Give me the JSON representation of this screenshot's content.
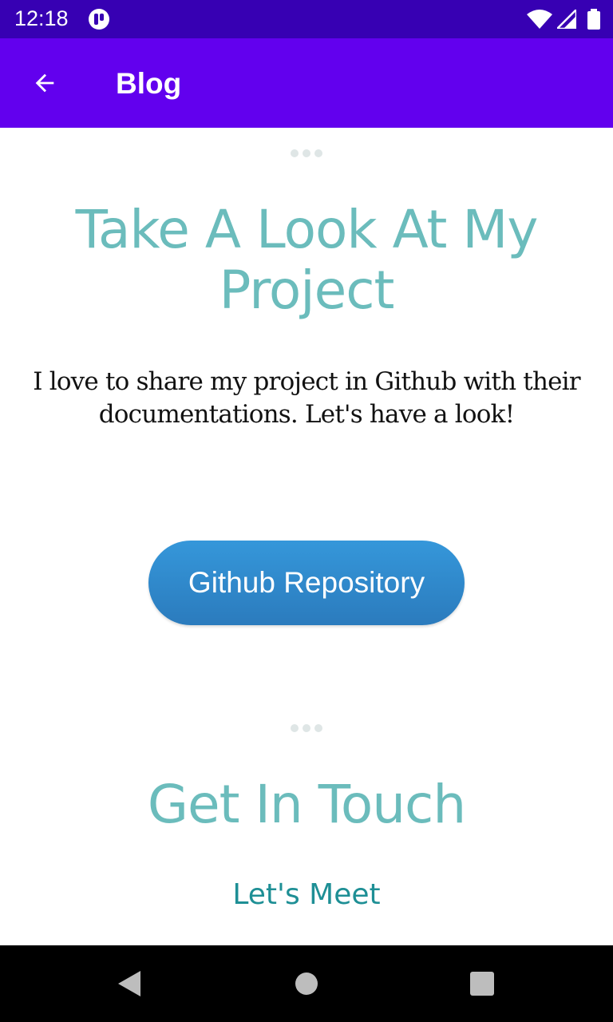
{
  "status_bar": {
    "time": "12:18",
    "icons": [
      "app-notification-icon",
      "wifi-icon",
      "signal-icon",
      "battery-icon"
    ]
  },
  "app_bar": {
    "title": "Blog",
    "back_icon": "arrow-back-icon"
  },
  "sections": [
    {
      "heading": "Take A Look At My Project",
      "body": "I love to share my project in Github with their documentations. Let's have a look!",
      "button_label": "Github Repository"
    },
    {
      "heading": "Get In Touch",
      "subheading": "Let's Meet"
    }
  ],
  "navigation": {
    "icons": [
      "nav-back-icon",
      "nav-home-icon",
      "nav-recents-icon"
    ]
  },
  "colors": {
    "status_bar": "#3700b3",
    "app_bar": "#6200ee",
    "heading": "#6bbcbc",
    "button": "#2f86c8",
    "sub_link": "#1e8f95"
  }
}
